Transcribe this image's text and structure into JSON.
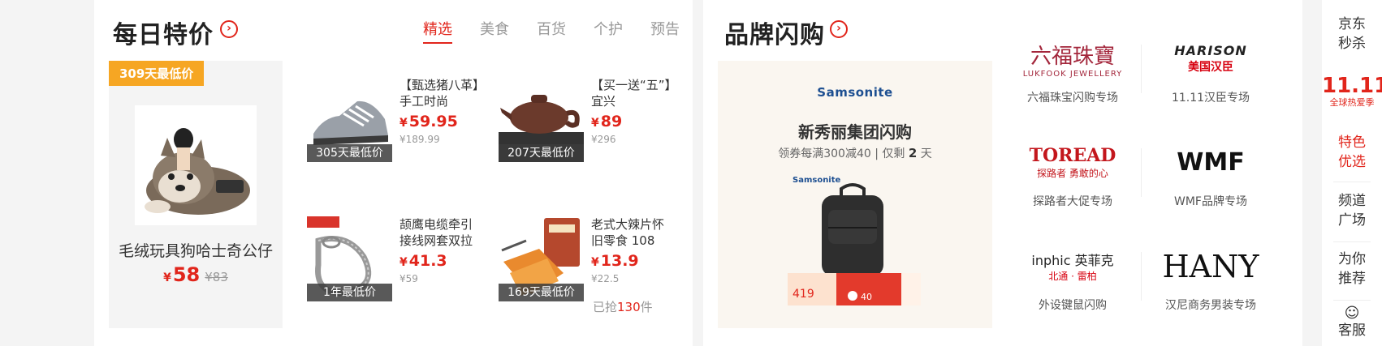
{
  "daily_deals": {
    "title": "每日特价",
    "tabs": [
      "精选",
      "美食",
      "百货",
      "个护",
      "预告"
    ],
    "featured": {
      "badge": "309天最低价",
      "name": "毛绒玩具狗哈士奇公仔",
      "currency": "¥",
      "price": "58",
      "original": "¥83"
    },
    "products": [
      {
        "name": "【甄选猪八革】手工时尚",
        "price": "59.95",
        "original": "¥189.99",
        "badge": "305天最低价"
      },
      {
        "name": "【买一送“五”】宜兴",
        "price": "89",
        "original": "¥296",
        "badge": "207天最低价"
      },
      {
        "name": "颉鹰电缆牵引接线网套双拉",
        "price": "41.3",
        "original": "¥59",
        "badge": "1年最低价"
      },
      {
        "name": "老式大辣片怀旧零食 108",
        "price": "13.9",
        "original": "¥22.5",
        "badge": "169天最低价"
      }
    ],
    "sold": {
      "prefix": "已抢",
      "count": "130",
      "suffix": "件"
    }
  },
  "brand_flash": {
    "title": "品牌闪购",
    "banner": {
      "logo": "Samsonite",
      "title": "新秀丽集团闪购",
      "sub_coupon": "领券每满300减40",
      "sub_days_prefix": "仅剩",
      "sub_days": "2",
      "sub_days_suffix": "天",
      "small_logo": "Samsonite",
      "promo_price": "419",
      "promo_coupon": "40"
    },
    "brands": [
      {
        "logo": "六福珠寶",
        "logo_sub": "LUKFOOK JEWELLERY",
        "name": "六福珠宝闪购专场"
      },
      {
        "logo": "HARISON",
        "logo_sub": "美国汉臣",
        "name": "11.11汉臣专场"
      },
      {
        "logo": "TOREAD",
        "logo_sub": "探路者 勇敢的心",
        "name": "探路者大促专场"
      },
      {
        "logo": "WMF",
        "logo_sub": "",
        "name": "WMF品牌专场"
      },
      {
        "logo": "inphic 英菲克",
        "logo_sub": "北通 · 雷柏",
        "name": "外设键鼠闪购"
      },
      {
        "logo": "HANY",
        "logo_sub": "",
        "name": "汉尼商务男装专场"
      }
    ]
  },
  "right_nav": {
    "items": [
      "京东秒杀",
      "特色优选",
      "频道广场",
      "为你推荐",
      "客服"
    ],
    "promo": "全球热爱季",
    "colors": {
      "accent": "#e1251b"
    }
  }
}
